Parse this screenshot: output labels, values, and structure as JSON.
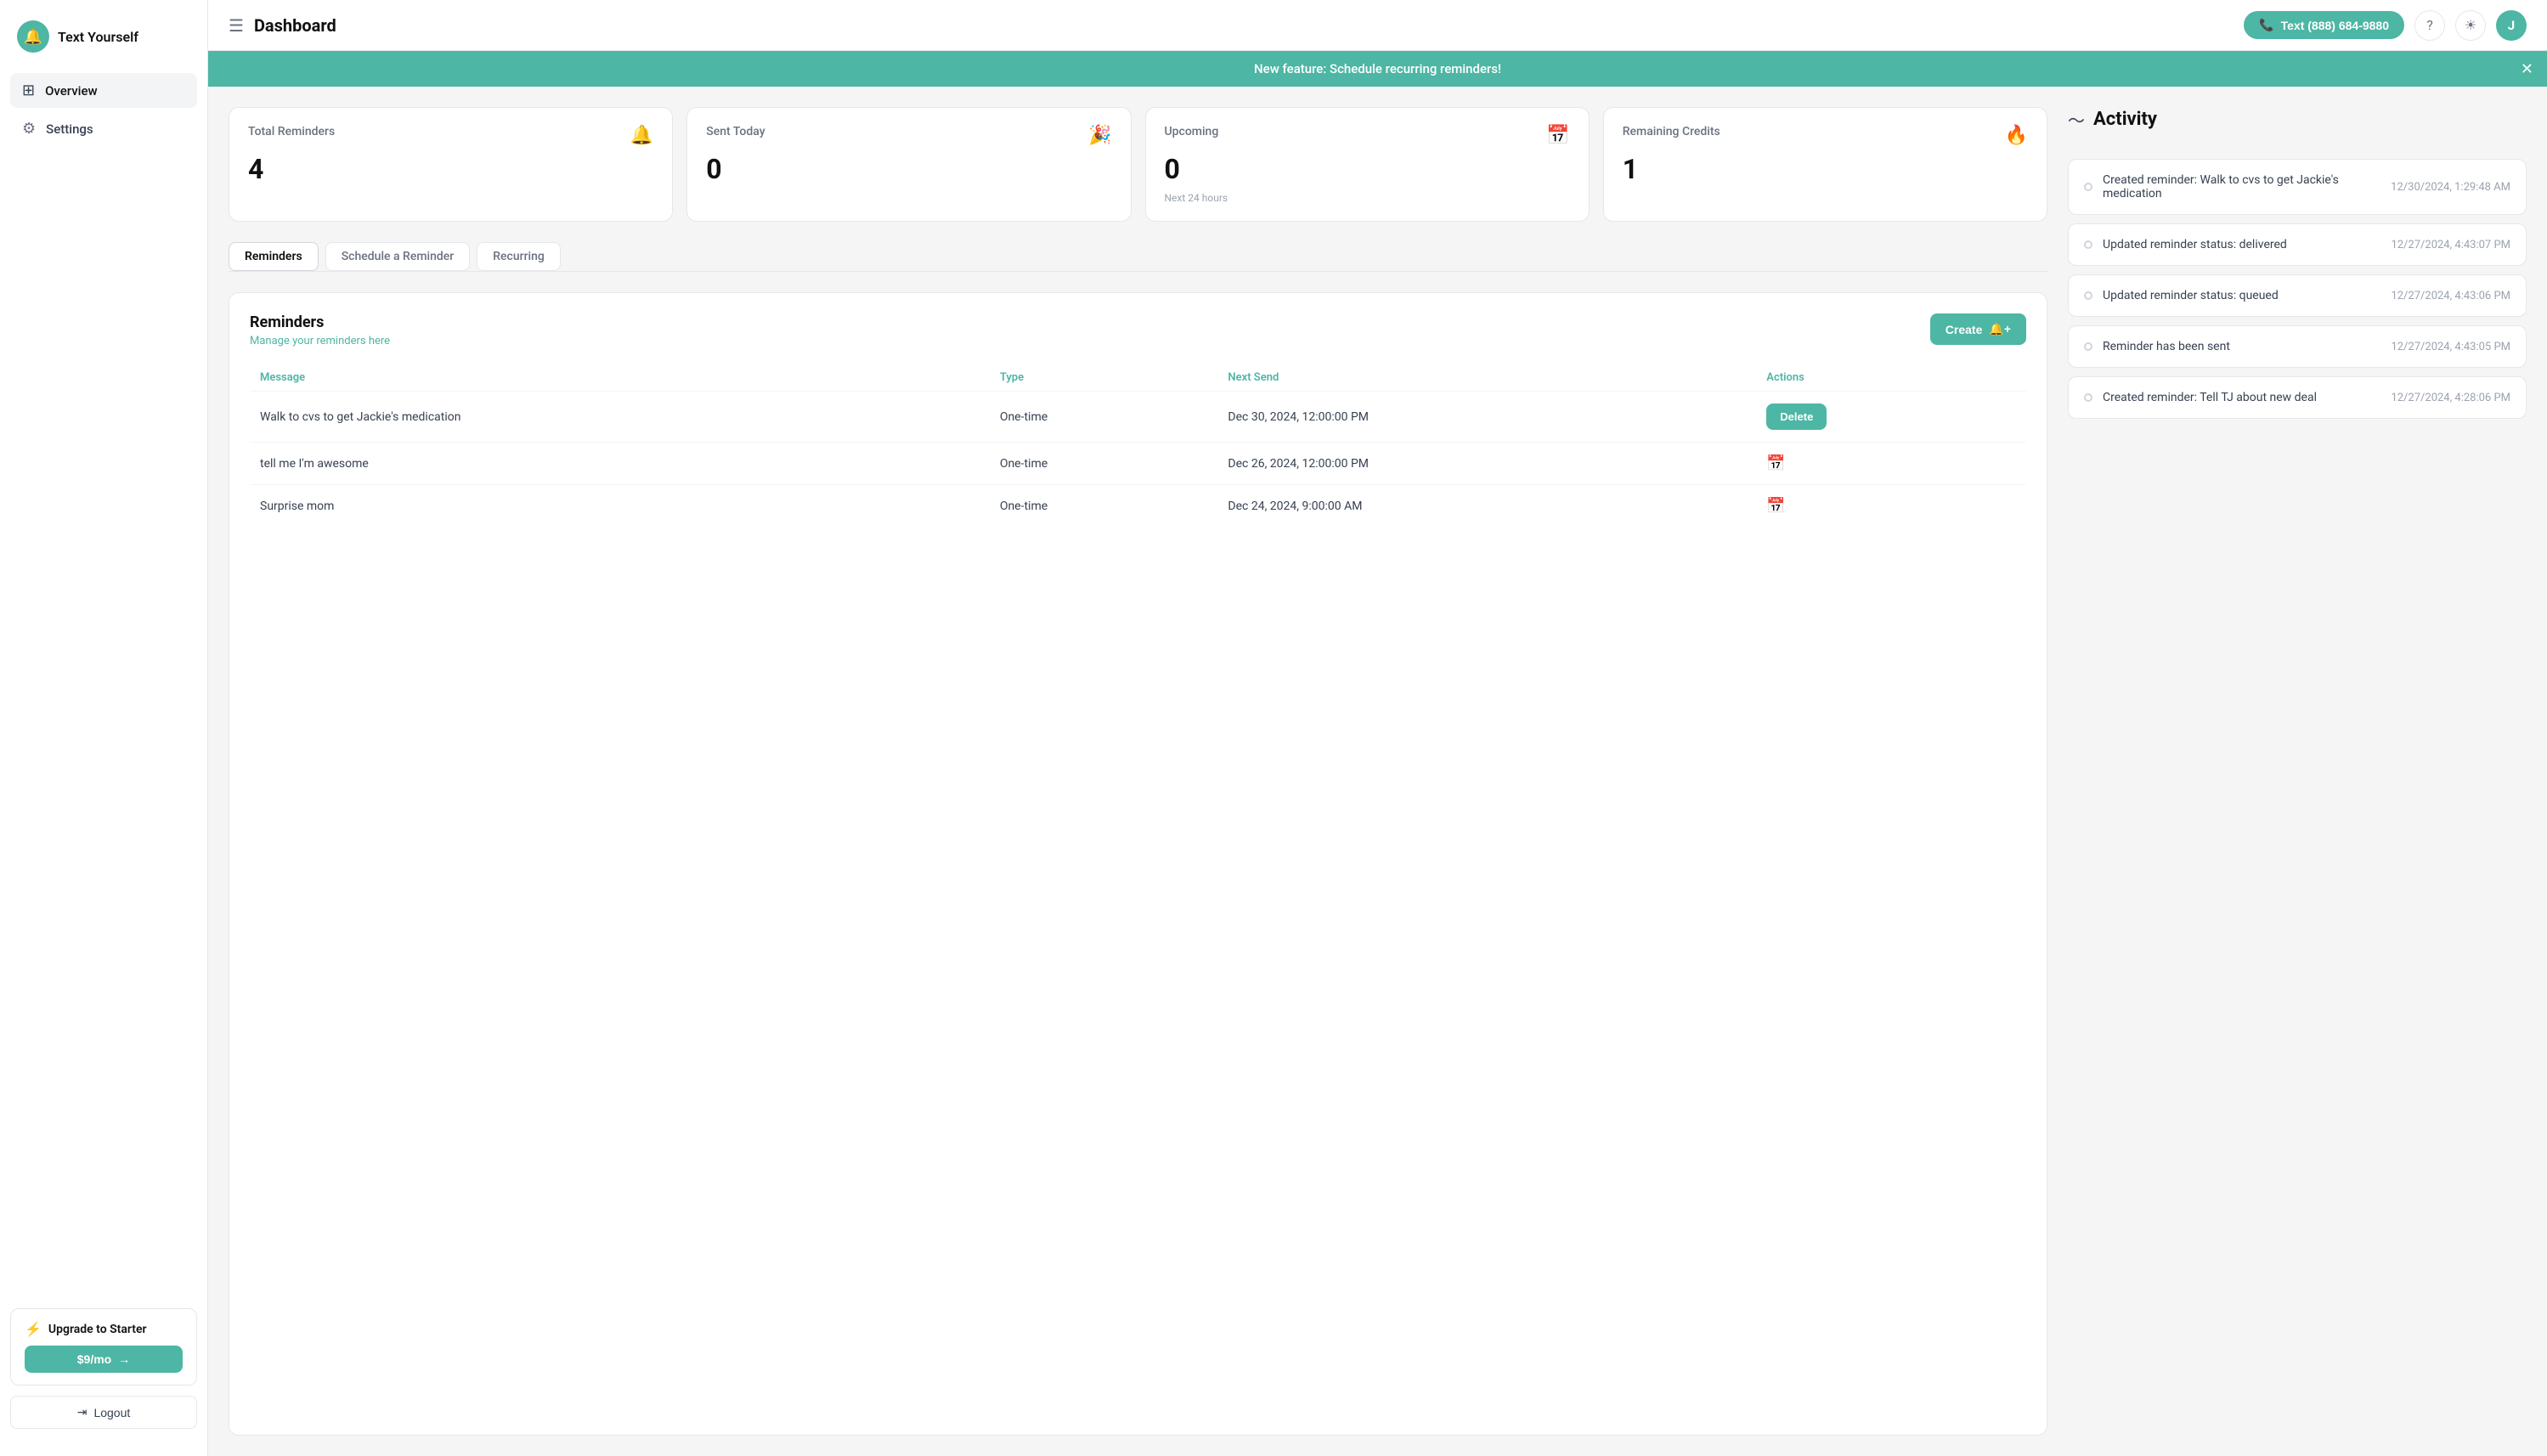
{
  "app": {
    "name": "Text Yourself",
    "logo_char": "🔔"
  },
  "sidebar": {
    "items": [
      {
        "id": "overview",
        "label": "Overview",
        "icon": "⊞",
        "active": true
      },
      {
        "id": "settings",
        "label": "Settings",
        "icon": "⚙",
        "active": false
      }
    ],
    "upgrade": {
      "title": "Upgrade to Starter",
      "icon": "⚡",
      "btn_label": "$9/mo",
      "btn_arrow": "→"
    },
    "logout_label": "Logout",
    "logout_icon": "⇥"
  },
  "header": {
    "title": "Dashboard",
    "phone_btn": "Text (888) 684-9880",
    "phone_icon": "📞",
    "toggle_icon": "☰",
    "help_icon": "?",
    "theme_icon": "☀",
    "avatar": "J"
  },
  "banner": {
    "text": "New feature: Schedule recurring reminders!",
    "close": "✕"
  },
  "stats": [
    {
      "label": "Total Reminders",
      "value": "4",
      "icon": "🔔",
      "sub": ""
    },
    {
      "label": "Sent Today",
      "value": "0",
      "icon": "🎉",
      "sub": ""
    },
    {
      "label": "Upcoming",
      "value": "0",
      "icon": "📅",
      "sub": "Next 24 hours"
    },
    {
      "label": "Remaining Credits",
      "value": "1",
      "icon": "🔥",
      "sub": ""
    }
  ],
  "tabs": [
    {
      "id": "reminders",
      "label": "Reminders",
      "active": true
    },
    {
      "id": "schedule",
      "label": "Schedule a Reminder",
      "active": false
    },
    {
      "id": "recurring",
      "label": "Recurring",
      "active": false
    }
  ],
  "reminders": {
    "title": "Reminders",
    "subtitle": "Manage your reminders here",
    "create_btn": "Create",
    "columns": [
      "Message",
      "Type",
      "Next Send",
      "Actions"
    ],
    "rows": [
      {
        "message": "Walk to cvs to get Jackie's medication",
        "type": "One-time",
        "next_send": "Dec 30, 2024, 12:00:00 PM",
        "action": "delete"
      },
      {
        "message": "tell me I'm awesome",
        "type": "One-time",
        "next_send": "Dec 26, 2024, 12:00:00 PM",
        "action": "calendar"
      },
      {
        "message": "Surprise mom",
        "type": "One-time",
        "next_send": "Dec 24, 2024, 9:00:00 AM",
        "action": "calendar"
      }
    ],
    "delete_label": "Delete"
  },
  "activity": {
    "title": "Activity",
    "icon": "〜",
    "items": [
      {
        "text": "Created reminder: Walk to cvs to get Jackie's medication",
        "time": "12/30/2024, 1:29:48 AM"
      },
      {
        "text": "Updated reminder status: delivered",
        "time": "12/27/2024, 4:43:07 PM"
      },
      {
        "text": "Updated reminder status: queued",
        "time": "12/27/2024, 4:43:06 PM"
      },
      {
        "text": "Reminder has been sent",
        "time": "12/27/2024, 4:43:05 PM"
      },
      {
        "text": "Created reminder: Tell TJ about new deal",
        "time": "12/27/2024, 4:28:06 PM"
      }
    ]
  }
}
